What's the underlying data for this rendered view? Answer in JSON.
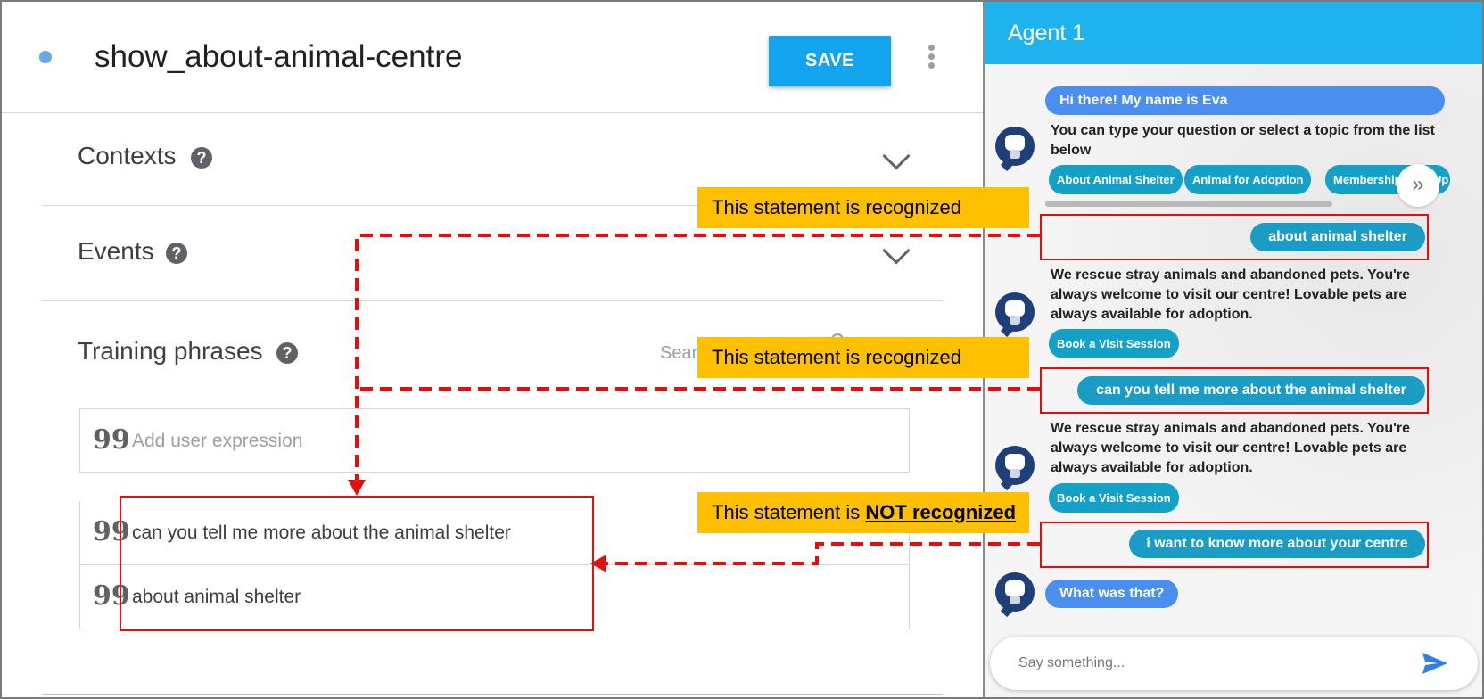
{
  "intent": {
    "title": "show_about-animal-centre",
    "save_label": "SAVE"
  },
  "sections": {
    "contexts": "Contexts",
    "events": "Events",
    "training_phrases": "Training phrases",
    "help_glyph": "?"
  },
  "training": {
    "search_placeholder": "Sear",
    "add_placeholder": "Add user expression",
    "quote_glyph": "99",
    "phrases": [
      "can you tell me more about the animal shelter",
      "about animal shelter"
    ]
  },
  "chat": {
    "header": "Agent 1",
    "greeting": "Hi there! My name is Eva",
    "intro_text": "You can type your question or select a topic from the list below",
    "topic_chips": [
      "About Animal Shelter",
      "Animal for Adoption",
      "Membership Sign Up"
    ],
    "next_glyph": "»",
    "user_msg_1": "about animal shelter",
    "bot_reply_1": "We rescue stray animals and abandoned pets. You're always welcome to visit our centre! Lovable pets are always available for adoption.",
    "visit_chip_1": "Book a Visit Session",
    "user_msg_2": "can you tell me more about the animal shelter",
    "bot_reply_2": "We rescue stray animals and abandoned pets. You're always welcome to visit our centre! Lovable pets are always available for adoption.",
    "visit_chip_2": "Book a Visit Session",
    "user_msg_3": "i want to know more about your centre",
    "fallback": "What was that?",
    "input_placeholder": "Say something..."
  },
  "annotations": {
    "recognized_1": "This statement is recognized",
    "recognized_2": "This statement is recognized",
    "not_recognized_prefix": "This statement is ",
    "not_recognized_emphasis": "NOT recognized"
  },
  "colors": {
    "header_blue": "#1eb3ee",
    "save_blue": "#12a4ef",
    "user_bubble": "#1b9cc4",
    "bot_bubble": "#4a8ff0",
    "callout": "#ffc000",
    "annotation_red": "#e01010"
  }
}
